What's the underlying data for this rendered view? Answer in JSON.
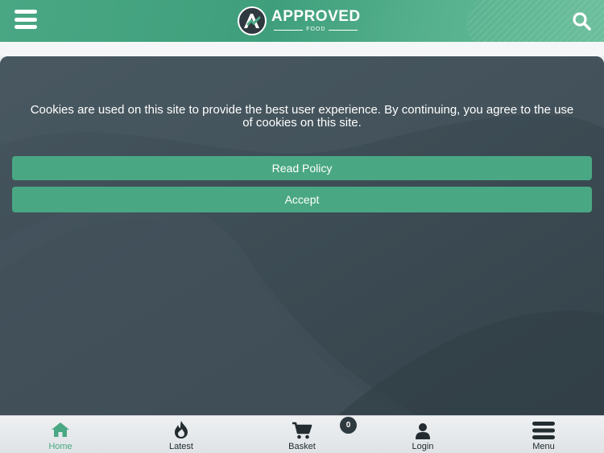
{
  "header": {
    "logo_main": "APPROVED",
    "logo_sub": "FOOD",
    "menu_icon": "hamburger-icon",
    "search_icon": "search-icon"
  },
  "cookie": {
    "message": "Cookies are used on this site to provide the best user experience. By continuing, you agree to the use of cookies on this site.",
    "read_policy_label": "Read Policy",
    "accept_label": "Accept"
  },
  "nav": {
    "items": [
      {
        "label": "Home",
        "icon": "home-icon",
        "active": true
      },
      {
        "label": "Latest",
        "icon": "flame-icon",
        "active": false
      },
      {
        "label": "Basket",
        "icon": "cart-icon",
        "active": false
      },
      {
        "label": "Login",
        "icon": "user-icon",
        "active": false
      },
      {
        "label": "Menu",
        "icon": "hamburger-icon",
        "active": false
      }
    ],
    "basket_count": "0"
  },
  "colors": {
    "brand_green": "#4aa784",
    "dark_slate": "#3b4a52",
    "badge_dark": "#2f3a40"
  }
}
